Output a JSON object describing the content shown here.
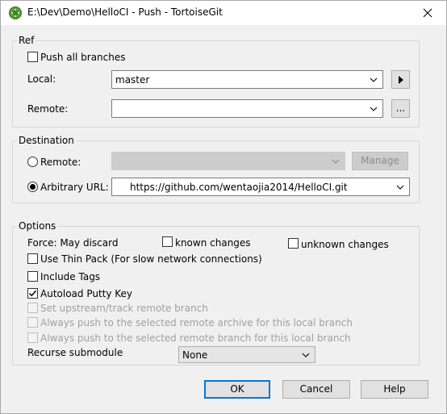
{
  "window": {
    "title": "E:\\Dev\\Demo\\HelloCI - Push - TortoiseGit",
    "app_icon": "tortoisegit-icon",
    "close_icon": "close-icon"
  },
  "ref": {
    "legend": "Ref",
    "push_all_branches": {
      "label": "Push all branches",
      "checked": false
    },
    "local_label": "Local:",
    "local_value": "master",
    "remote_label": "Remote:",
    "remote_value": "",
    "browse_icon": "play-arrow-icon",
    "ellipsis_label": "..."
  },
  "destination": {
    "legend": "Destination",
    "remote_label": "Remote:",
    "remote_value": "",
    "manage_label": "Manage",
    "arbitrary_url_label": "Arbitrary URL:",
    "arbitrary_url_value": "https://github.com/wentaojia2014/HelloCI.git",
    "selected": "arbitrary_url"
  },
  "options": {
    "legend": "Options",
    "force_label": "Force: May discard",
    "known_changes": {
      "label": "known changes",
      "checked": false
    },
    "unknown_changes": {
      "label": "unknown changes",
      "checked": false
    },
    "thin_pack": {
      "label": "Use Thin Pack (For slow network connections)",
      "checked": false
    },
    "include_tags": {
      "label": "Include Tags",
      "checked": false
    },
    "autoload_putty": {
      "label": "Autoload Putty Key",
      "checked": true
    },
    "set_upstream": {
      "label": "Set upstream/track remote branch",
      "checked": false,
      "enabled": false
    },
    "always_push_archive": {
      "label": "Always push to the selected remote archive for this local branch",
      "checked": false,
      "enabled": false
    },
    "always_push_branch": {
      "label": "Always push to the selected remote branch for this local branch",
      "checked": false,
      "enabled": false
    },
    "recurse_label": "Recurse submodule",
    "recurse_value": "None"
  },
  "buttons": {
    "ok": "OK",
    "cancel": "Cancel",
    "help": "Help"
  },
  "colors": {
    "default_button_border": "#0078d7",
    "disabled_text": "#a0a0a0"
  }
}
